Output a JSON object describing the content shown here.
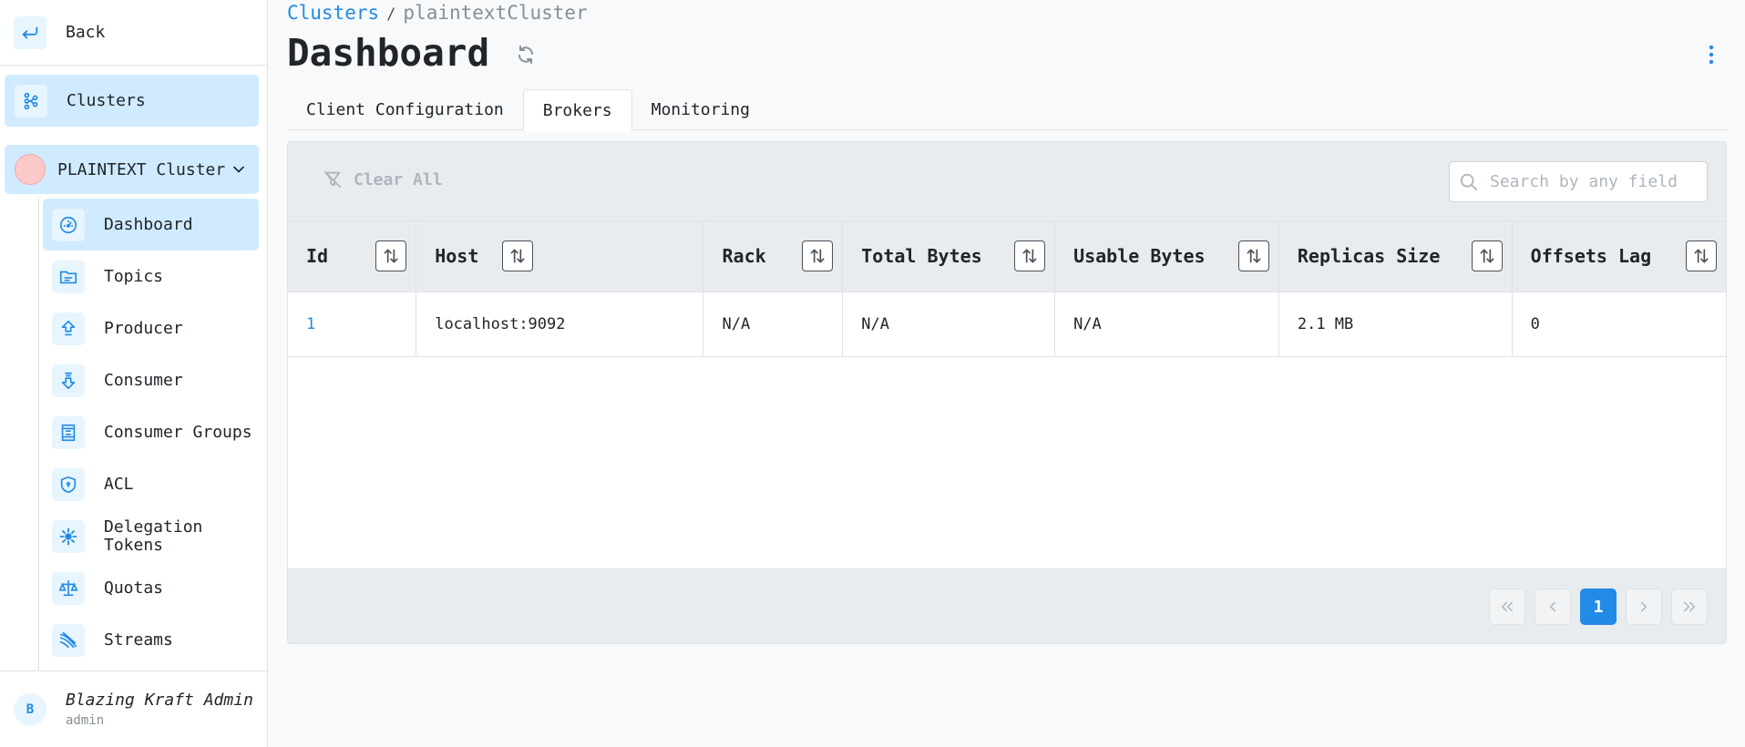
{
  "sidebar": {
    "back_label": "Back",
    "clusters_label": "Clusters",
    "cluster_name": "PLAINTEXT Cluster",
    "cluster_color": "#fcc9c9",
    "items": [
      {
        "label": "Dashboard",
        "icon": "dashboard-icon",
        "active": true
      },
      {
        "label": "Topics",
        "icon": "topics-icon"
      },
      {
        "label": "Producer",
        "icon": "producer-icon"
      },
      {
        "label": "Consumer",
        "icon": "consumer-icon"
      },
      {
        "label": "Consumer Groups",
        "icon": "consumer-groups-icon"
      },
      {
        "label": "ACL",
        "icon": "shield-icon"
      },
      {
        "label": "Delegation Tokens",
        "icon": "delegation-tokens-icon"
      },
      {
        "label": "Quotas",
        "icon": "scale-icon"
      },
      {
        "label": "Streams",
        "icon": "streams-icon"
      }
    ],
    "user": {
      "initial": "B",
      "name": "Blazing Kraft Admin",
      "role": "admin"
    }
  },
  "breadcrumb": {
    "link": "Clusters",
    "separator": "/",
    "current": "plaintextCluster"
  },
  "page": {
    "title": "Dashboard"
  },
  "tabs": [
    "Client Configuration",
    "Brokers",
    "Monitoring"
  ],
  "active_tab": "Brokers",
  "toolbar": {
    "clear_all": "Clear All",
    "search_placeholder": "Search by any field"
  },
  "table": {
    "columns": [
      "Id",
      "Host",
      "Rack",
      "Total Bytes",
      "Usable Bytes",
      "Replicas Size",
      "Offsets Lag"
    ],
    "rows": [
      [
        "1",
        "localhost:9092",
        "N/A",
        "N/A",
        "N/A",
        "2.1 MB",
        "0"
      ]
    ]
  },
  "pagination": {
    "current": "1"
  },
  "colors": {
    "accent": "#228be6",
    "accent_light": "#d0ebff"
  }
}
